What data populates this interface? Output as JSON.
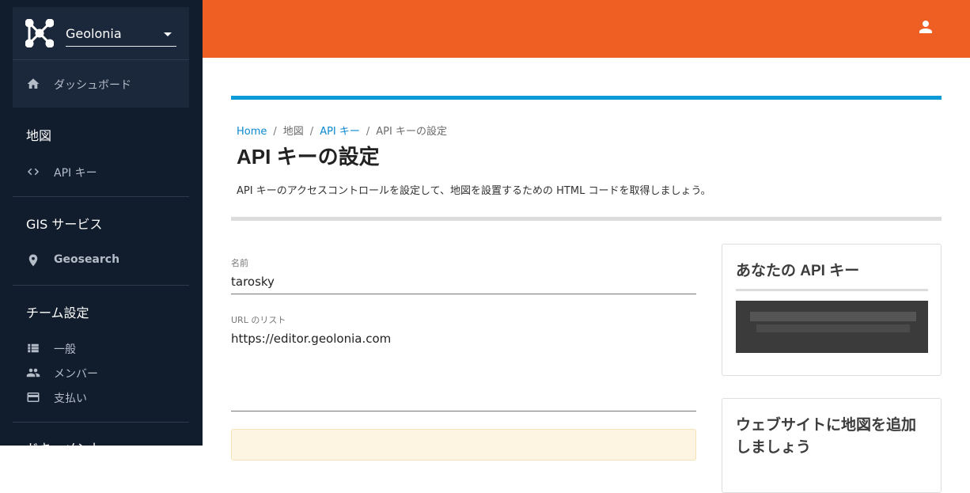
{
  "workspace": {
    "name": "Geolonia"
  },
  "sidebar": {
    "dashboard": {
      "label": "ダッシュボード",
      "icon": "home-icon"
    },
    "sections": [
      {
        "title": "地図",
        "items": [
          {
            "label": "API キー",
            "icon": "code-icon"
          }
        ]
      },
      {
        "title": "GIS サービス",
        "items": [
          {
            "label": "Geosearch",
            "icon": "location-pin-icon"
          }
        ]
      },
      {
        "title": "チーム設定",
        "items": [
          {
            "label": "一般",
            "icon": "list-icon"
          },
          {
            "label": "メンバー",
            "icon": "people-icon"
          },
          {
            "label": "支払い",
            "icon": "credit-card-icon"
          }
        ]
      },
      {
        "title": "ドキュメント",
        "items": []
      }
    ]
  },
  "topbar": {
    "color": "#ef5f24",
    "user_icon": "account-icon"
  },
  "breadcrumb": {
    "home": "Home",
    "map": "地図",
    "api_keys": "API キー",
    "current": "API キーの設定"
  },
  "page": {
    "title": "API キーの設定",
    "description": "API キーのアクセスコントロールを設定して、地図を設置するための HTML コードを取得しましょう。"
  },
  "form": {
    "name": {
      "label": "名前",
      "value": "tarosky"
    },
    "urls": {
      "label": "URL のリスト",
      "value": "https://editor.geolonia.com"
    }
  },
  "api_key_card": {
    "title": "あなたの API キー",
    "value": ""
  },
  "embed_card": {
    "title": "ウェブサイトに地図を追加しましょう"
  },
  "colors": {
    "accent": "#ef5f24",
    "link": "#0b88d0",
    "sidebar": "#111c2d",
    "progress": "#0d9bd8"
  }
}
